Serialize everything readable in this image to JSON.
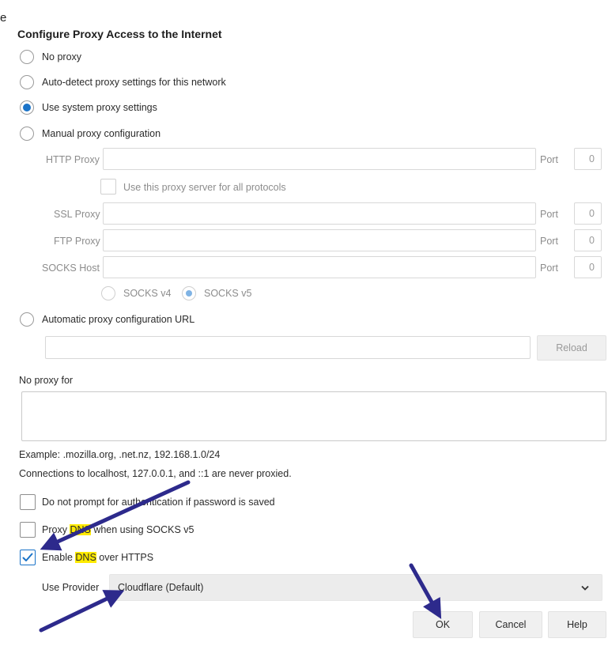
{
  "fragment": "e",
  "dialog": {
    "title": "Configure Proxy Access to the Internet",
    "options": {
      "no_proxy": "No proxy",
      "auto_detect": "Auto-detect proxy settings for this network",
      "use_system": "Use system proxy settings",
      "manual": "Manual proxy configuration",
      "auto_url": "Automatic proxy configuration URL"
    },
    "selected_option": "use_system",
    "manual": {
      "http_label": "HTTP Proxy",
      "ssl_label": "SSL Proxy",
      "ftp_label": "FTP Proxy",
      "socks_label": "SOCKS Host",
      "port_label": "Port",
      "port_http": "0",
      "port_ssl": "0",
      "port_ftp": "0",
      "port_socks": "0",
      "use_all_label": "Use this proxy server for all protocols",
      "socks_v4": "SOCKS v4",
      "socks_v5": "SOCKS v5",
      "socks_selected": "SOCKS v5"
    },
    "reload_label": "Reload",
    "no_proxy_label": "No proxy for",
    "example_text": "Example: .mozilla.org, .net.nz, 192.168.1.0/24",
    "localhost_text": "Connections to localhost, 127.0.0.1, and ::1 are never proxied.",
    "checkboxes": {
      "no_prompt": "Do not prompt for authentication if password is saved",
      "proxy_dns_pre": "Proxy ",
      "proxy_dns_hl": "DNS",
      "proxy_dns_post": " when using SOCKS v5",
      "doh_pre": "Enable ",
      "doh_hl": "DNS",
      "doh_post": " over HTTPS",
      "doh_checked": true
    },
    "provider_label": "Use Provider",
    "provider_value": "Cloudflare (Default)",
    "buttons": {
      "ok": "OK",
      "cancel": "Cancel",
      "help": "Help"
    },
    "highlight_color": "#ffea00",
    "accent_color": "#1a73c8",
    "annotation_arrow_color": "#2d2a8c"
  }
}
